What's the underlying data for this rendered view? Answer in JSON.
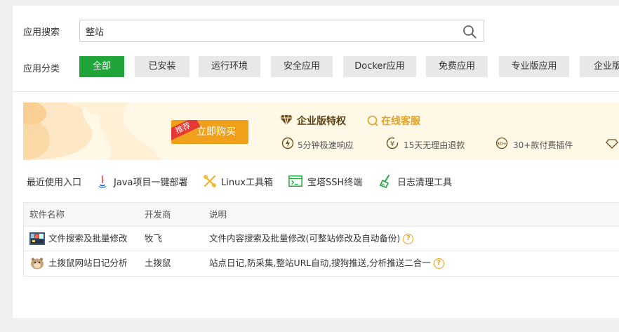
{
  "search": {
    "label": "应用搜索",
    "value": "整站"
  },
  "categories": {
    "label": "应用分类",
    "items": [
      "全部",
      "已安装",
      "运行环境",
      "安全应用",
      "Docker应用",
      "免费应用",
      "专业版应用",
      "企业版"
    ],
    "active_index": 0
  },
  "banner": {
    "ribbon": "推荐",
    "buy_label": "立即购买",
    "enterprise_title": "企业版特权",
    "customer_service": "在线客服",
    "features": [
      "5分钟极速响应",
      "15天无理由退款",
      "30+款付费插件"
    ]
  },
  "recent": {
    "label": "最近使用入口",
    "items": [
      "Java项目一键部署",
      "Linux工具箱",
      "宝塔SSH终端",
      "日志清理工具"
    ]
  },
  "table": {
    "headers": [
      "软件名称",
      "开发商",
      "说明"
    ],
    "rows": [
      {
        "name": "文件搜索及批量修改",
        "developer": "牧飞",
        "desc": "文件内容搜索及批量修改(可整站修改及自动备份)"
      },
      {
        "name": "土拨鼠网站日记分析",
        "developer": "土拨鼠",
        "desc": "站点日记,防采集,整站URL自动,搜狗推送,分析推送二合一"
      }
    ],
    "help_glyph": "?"
  },
  "colors": {
    "accent": "#20a53a",
    "buy": "#f0a01a",
    "banner_bg": "#fff8e6"
  }
}
